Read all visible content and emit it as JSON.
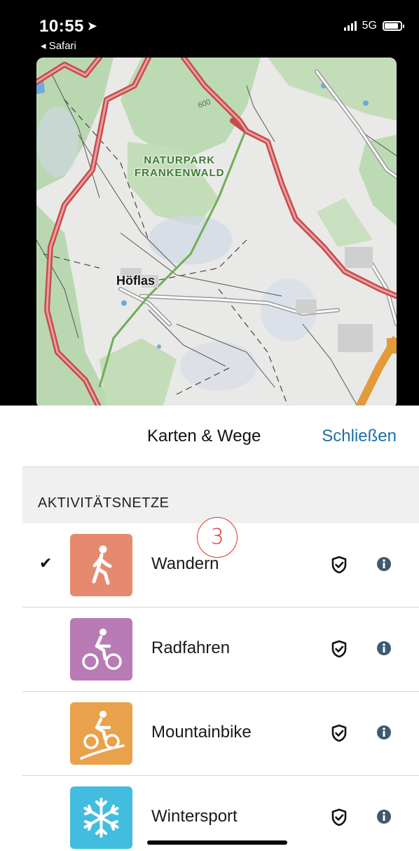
{
  "status_bar": {
    "time": "10:55",
    "back_label": "Safari",
    "network": "5G"
  },
  "map": {
    "park_label_line1": "NATURPARK",
    "park_label_line2": "FRANKENWALD",
    "town_label": "Höflas",
    "road_label": "600"
  },
  "sheet": {
    "title": "Karten & Wege",
    "close_label": "Schließen",
    "section_title": "AKTIVITÄTSNETZE",
    "annotation_number": "3",
    "items": [
      {
        "label": "Wandern",
        "checked": true,
        "color": "#e58a6f",
        "icon": "hiking-icon"
      },
      {
        "label": "Radfahren",
        "checked": false,
        "color": "#b87bb5",
        "icon": "cycling-icon"
      },
      {
        "label": "Mountainbike",
        "checked": false,
        "color": "#e9a24b",
        "icon": "mountainbike-icon"
      },
      {
        "label": "Wintersport",
        "checked": false,
        "color": "#42bde0",
        "icon": "snowflake-icon"
      }
    ]
  }
}
